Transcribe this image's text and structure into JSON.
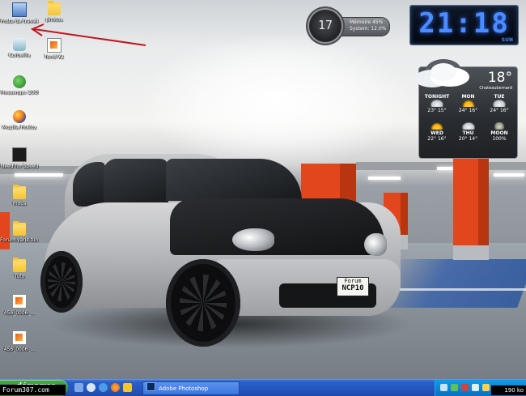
{
  "desktop_icons": [
    {
      "label": "Poste de travail",
      "icon": "computer-icon"
    },
    {
      "label": "Corbeille",
      "icon": "recycle-bin-icon"
    },
    {
      "label": "Messenger 2009",
      "icon": "messenger-icon"
    },
    {
      "label": "Mozilla Firefox",
      "icon": "firefox-icon"
    },
    {
      "label": "Need for Speed",
      "icon": "game-icon"
    },
    {
      "label": "mods",
      "icon": "folder-icon"
    },
    {
      "label": "Forum yaris tuning",
      "icon": "folder-icon"
    },
    {
      "label": "Tuto",
      "icon": "folder-icon"
    },
    {
      "label": "456_0006_...",
      "icon": "image-file-icon"
    },
    {
      "label": "456_0006_...",
      "icon": "image-file-icon"
    },
    {
      "label": "photos",
      "icon": "folder-icon"
    },
    {
      "label": "fond V2",
      "icon": "image-file-icon"
    }
  ],
  "cpu_gadget": {
    "value": "17",
    "line1": "Mémoire 45%",
    "line2": "System: 12.0%"
  },
  "clock_gadget": {
    "time": "21:18",
    "day": "SUN"
  },
  "weather_gadget": {
    "temperature": "18°",
    "location": "Chateaubernard",
    "forecast_top": [
      {
        "day": "TONIGHT",
        "temps": "23° 15°",
        "symbol": "cloudy"
      },
      {
        "day": "MON",
        "temps": "24° 16°",
        "symbol": "sun"
      },
      {
        "day": "TUE",
        "temps": "24° 16°",
        "symbol": "cloudy"
      }
    ],
    "forecast_bottom": [
      {
        "day": "WED",
        "temps": "22° 16°",
        "symbol": "sun"
      },
      {
        "day": "THU",
        "temps": "20° 14°",
        "symbol": "cloudy"
      },
      {
        "day": "MOON",
        "temps": "100%",
        "symbol": "moon"
      }
    ]
  },
  "plate": {
    "line1": "Forum",
    "line2": "NCP10"
  },
  "taskbar": {
    "start_label": "démarrer",
    "active_window": "Adobe Photoshop"
  },
  "watermark": {
    "left": "Forum307.com",
    "right": "190 ko"
  },
  "colors": {
    "clock_blue": "#4b8cff",
    "taskbar_blue": "#2456bf",
    "start_green": "#3a9b38",
    "arrow_red": "#c0161b"
  }
}
